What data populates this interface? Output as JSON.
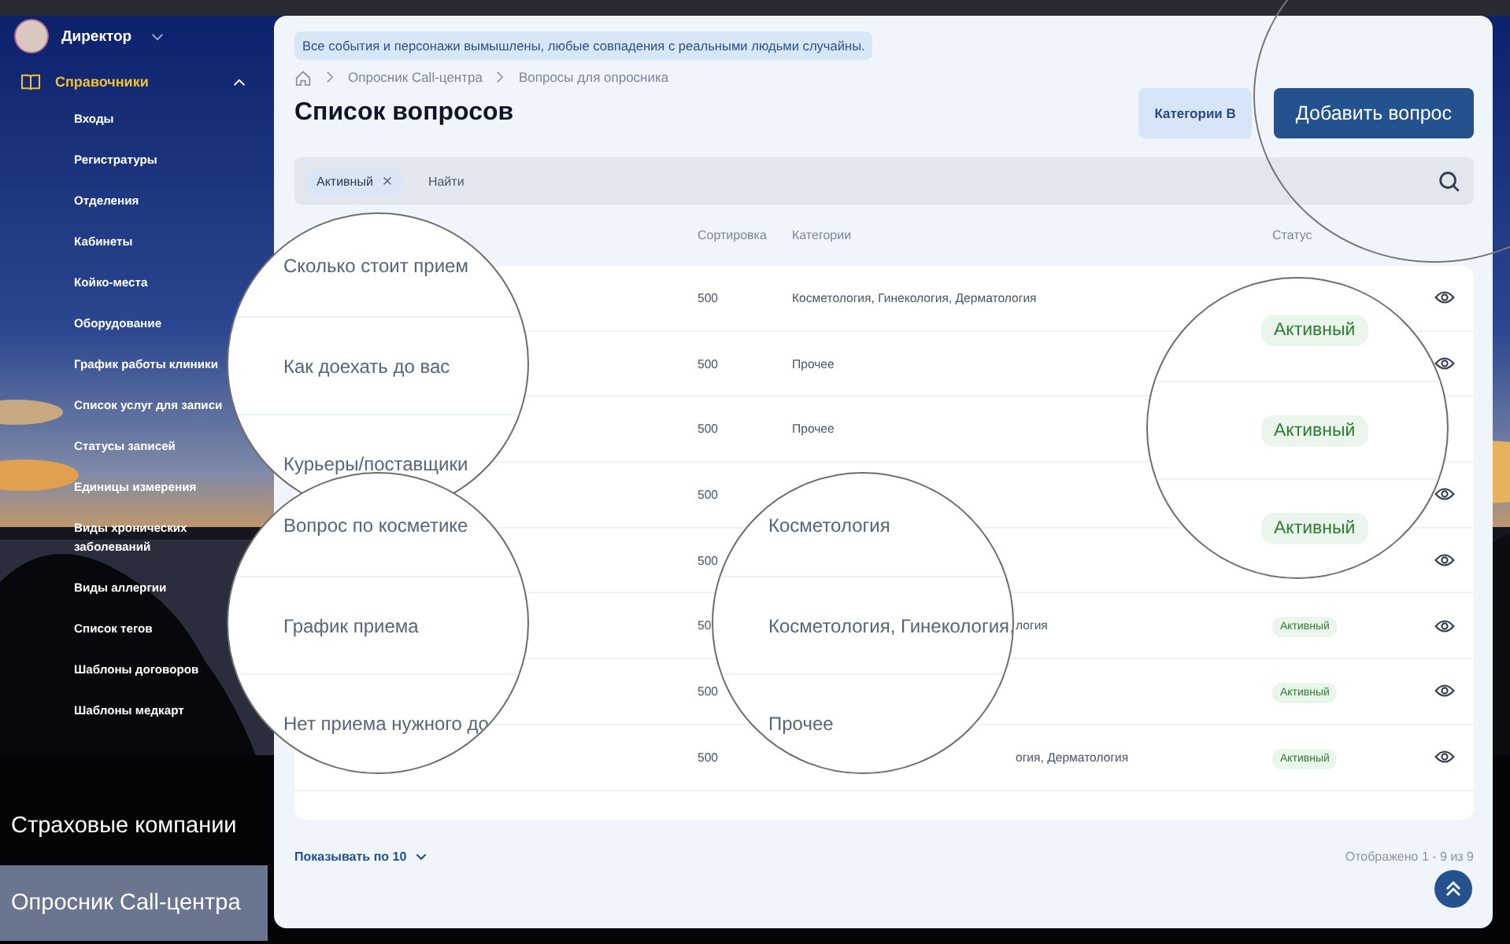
{
  "sidebar": {
    "user": "Директор",
    "section": {
      "label": "Справочники",
      "expanded": true
    },
    "items": [
      {
        "label": "Входы"
      },
      {
        "label": "Регистратуры"
      },
      {
        "label": "Отделения"
      },
      {
        "label": "Кабинеты"
      },
      {
        "label": "Койко-места"
      },
      {
        "label": "Оборудование"
      },
      {
        "label": "График работы клиники"
      },
      {
        "label": "Список услуг для записи"
      },
      {
        "label": "Статусы записей"
      },
      {
        "label": "Единицы измерения"
      },
      {
        "label": "Виды хронических заболеваний"
      },
      {
        "label": "Виды аллергии"
      },
      {
        "label": "Список тегов"
      },
      {
        "label": "Шаблоны договоров"
      },
      {
        "label": "Шаблоны медкарт"
      }
    ],
    "bottom_items": [
      {
        "label": "Страховые компании",
        "selected": false
      },
      {
        "label": "Опросник Call-центра",
        "selected": true
      }
    ]
  },
  "notice": "Все события и персонажи вымышлены, любые совпадения с реальными людьми случайны.",
  "breadcrumbs": [
    "Опросник Call-центра",
    "Вопросы для опросника"
  ],
  "title": "Список вопросов",
  "buttons": [
    {
      "label": "Категории В",
      "kind": "secondary"
    },
    {
      "label": "Добавить вопрос",
      "kind": "primary"
    }
  ],
  "filter": {
    "chips": [
      "Активный"
    ],
    "placeholder": "Найти"
  },
  "table": {
    "columns": [
      "",
      "Сортировка",
      "Категории",
      "Статус"
    ],
    "rows": [
      {
        "sort": "500",
        "category": "Косметология, Гинекология, Дерматология",
        "eye": true
      },
      {
        "sort": "500",
        "category": "Прочее",
        "eye": true
      },
      {
        "sort": "500",
        "category": "Прочее",
        "eye": false
      },
      {
        "sort": "500",
        "eye": true
      },
      {
        "sort": "500",
        "eye": true
      },
      {
        "sort": "50",
        "category_tail": "логия",
        "status": "Активный",
        "eye": true
      },
      {
        "sort": "500",
        "status": "Активный",
        "eye": true
      },
      {
        "sort": "500",
        "category_tail": "огия, Дерматология",
        "status": "Активный",
        "eye": true
      }
    ]
  },
  "magnifiers": [
    {
      "kind": "text",
      "lines": [
        "Сколько стоит прием",
        "Как доехать до вас",
        "Курьеры/поставщики"
      ]
    },
    {
      "kind": "text",
      "lines": [
        "Вопрос по косметике",
        "График приема",
        "Нет приема нужного до"
      ]
    },
    {
      "kind": "text",
      "lines": [
        "Косметология",
        "Косметология, Гинекология,",
        "Прочее"
      ]
    },
    {
      "kind": "status",
      "lines": [
        "Активный",
        "Активный",
        "Активный"
      ]
    }
  ],
  "footer": {
    "page_size": "Показывать по 10",
    "range": "Отображено 1 - 9 из 9"
  }
}
